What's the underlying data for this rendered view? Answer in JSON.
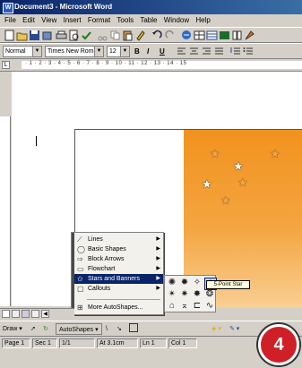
{
  "window": {
    "title": "Document3 - Microsoft Word"
  },
  "menubar": [
    "File",
    "Edit",
    "View",
    "Insert",
    "Format",
    "Tools",
    "Table",
    "Window",
    "Help"
  ],
  "formatting": {
    "style": "Normal",
    "font": "Times New Roman",
    "size": "12",
    "bold": "B",
    "italic": "I",
    "underline": "U"
  },
  "ruler": {
    "marks": "· 1 · 2 · 3 · 4 · 5 · 6 · 7 · 8 · 9 · 10 · 11 · 12 · 13 · 14 · 15"
  },
  "autoshapes_menu": {
    "items": [
      {
        "label": "Lines",
        "icon": "lines-icon"
      },
      {
        "label": "Basic Shapes",
        "icon": "basic-shapes-icon"
      },
      {
        "label": "Block Arrows",
        "icon": "block-arrows-icon"
      },
      {
        "label": "Flowchart",
        "icon": "flowchart-icon"
      },
      {
        "label": "Stars and Banners",
        "icon": "stars-banners-icon",
        "selected": true
      },
      {
        "label": "Callouts",
        "icon": "callouts-icon"
      },
      {
        "label": "More AutoShapes...",
        "icon": "more-autoshapes-icon"
      }
    ]
  },
  "stars_submenu": {
    "tooltip": "5-Point Star"
  },
  "drawing_toolbar": {
    "draw": "Draw",
    "autoshapes": "AutoShapes"
  },
  "statusbar": {
    "page": "Page 1",
    "sec": "Sec 1",
    "pages": "1/1",
    "at": "At 3.1cm",
    "ln": "Ln 1",
    "col": "Col 1"
  },
  "step_badge": "4",
  "colors": {
    "banner_top": "#f1921f",
    "banner_bottom": "#f9cf94",
    "menu_highlight": "#0a246a",
    "badge": "#cf2027"
  }
}
